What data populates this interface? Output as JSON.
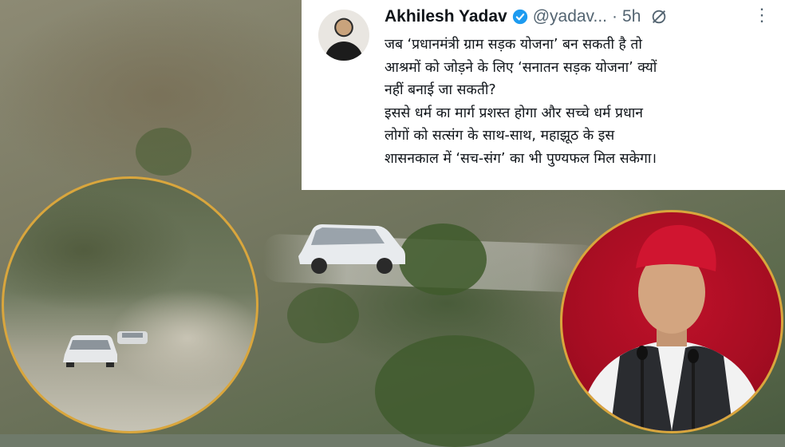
{
  "tweet": {
    "author_name": "Akhilesh Yadav",
    "handle": "@yadav...",
    "separator": "·",
    "time": "5h",
    "more_icon": "⋮",
    "text_lines": [
      "जब ‘प्रधानमंत्री ग्राम सड़क योजना’ बन सकती है तो",
      "आश्रमों को जोड़ने के लिए ‘सनातन सड़क योजना’ क्यों",
      "नहीं बनाई जा सकती?",
      "इससे धर्म का मार्ग प्रशस्त होगा और सच्चे धर्म प्रधान",
      "लोगों को सत्संग के साथ-साथ, महाझूठ के इस",
      "शासनकाल में ‘सच-संग’ का भी पुण्यफल मिल सकेगा।"
    ]
  },
  "colors": {
    "verified": "#1d9bf0",
    "inset_border": "#d9a63d",
    "cap_red": "#d01530"
  },
  "icons": [
    "verified-badge-icon",
    "mute-bell-icon",
    "more-options-icon"
  ]
}
